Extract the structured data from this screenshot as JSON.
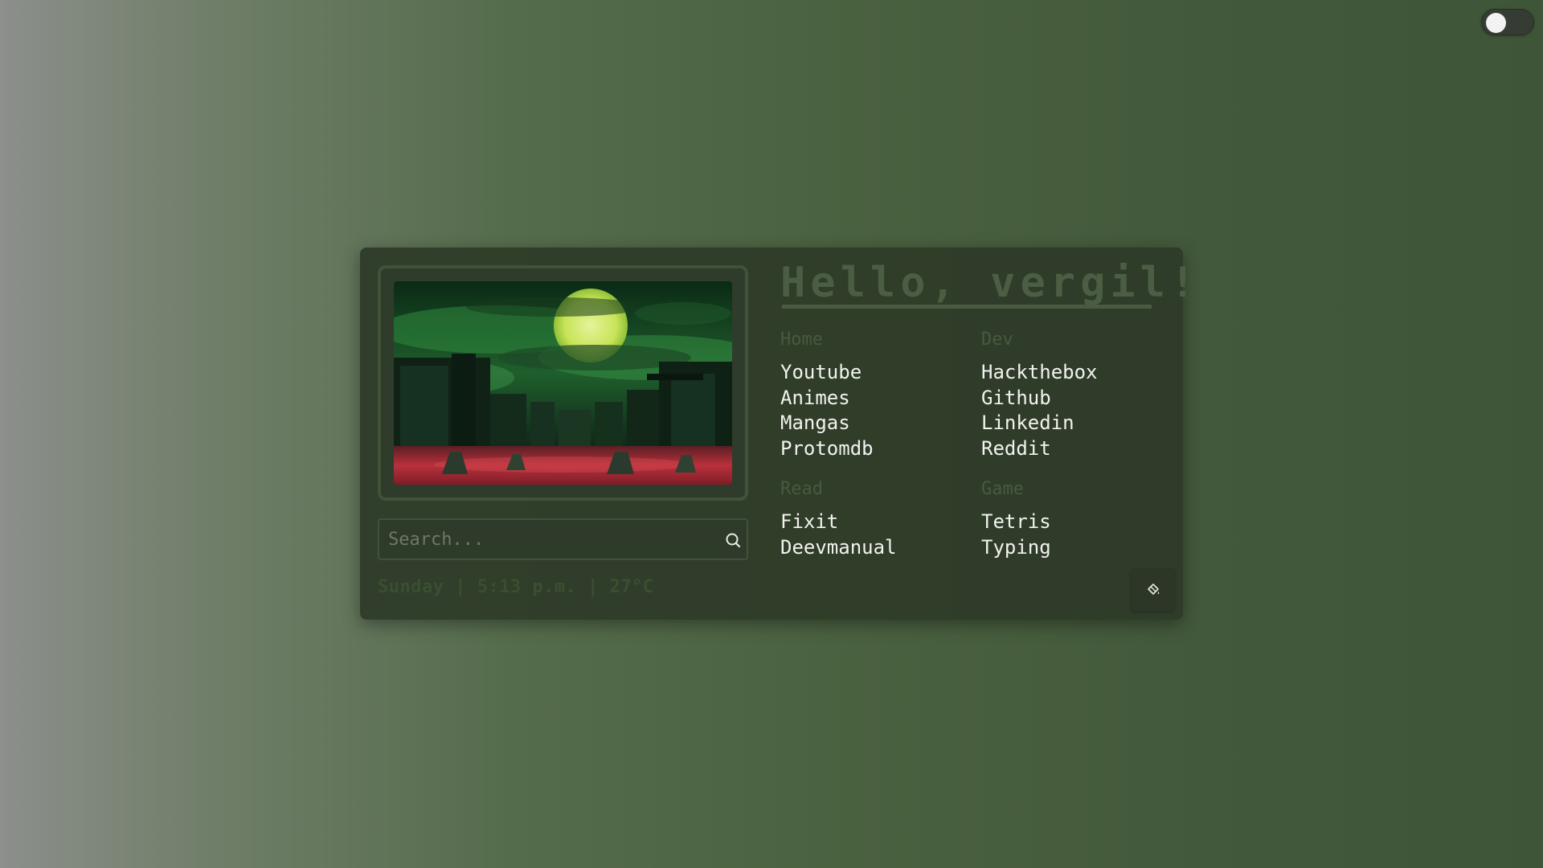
{
  "greeting": "Hello, vergil!",
  "search": {
    "placeholder": "Search..."
  },
  "status": "Sunday | 5:13 p.m. | 27°C",
  "groups": [
    {
      "title": "Home",
      "links": [
        "Youtube",
        "Animes",
        "Mangas",
        "Protomdb"
      ]
    },
    {
      "title": "Dev",
      "links": [
        "Hackthebox",
        "Github",
        "Linkedin",
        "Reddit"
      ]
    },
    {
      "title": "Read",
      "links": [
        "Fixit",
        "Deevmanual"
      ]
    },
    {
      "title": "Game",
      "links": [
        "Tetris",
        "Typing"
      ]
    }
  ],
  "icons": {
    "search": "search-icon",
    "settings": "paint-bucket-icon",
    "theme_toggle": "toggle-switch"
  },
  "colors": {
    "accent_text": "#4b5d42",
    "link_text": "#f2f3ef",
    "card_background": "#2d3a28"
  }
}
